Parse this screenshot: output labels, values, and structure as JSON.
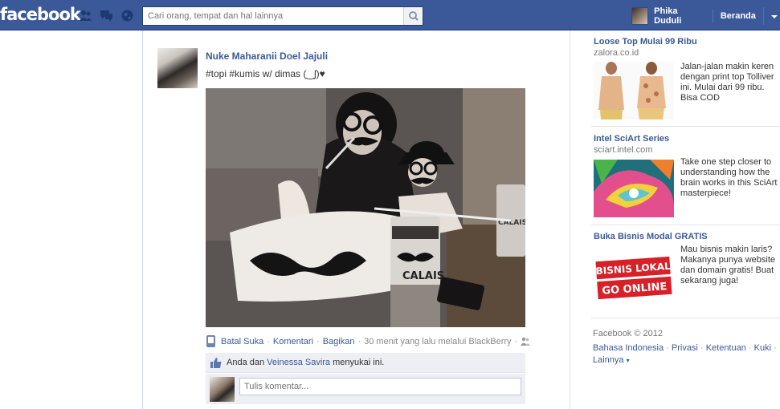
{
  "header": {
    "logo": "facebook",
    "search_placeholder": "Cari orang, tempat dan hal lainnya",
    "user_name": "Phika Duduli",
    "home_label": "Beranda"
  },
  "post": {
    "author": "Nuke Maharanii Doel Jajuli",
    "text": "#topi #kumis w/ dimas (‿ʃ)♥",
    "photo_texts": {
      "cup": "CALAIS",
      "cup_back": "CALAIS"
    },
    "actions": {
      "unlike": "Batal Suka",
      "comment": "Komentari",
      "share": "Bagikan",
      "timestamp": "30 menit yang lalu melalui BlackBerry"
    },
    "likes": {
      "you_and": "Anda dan",
      "friend": "Veinessa Savira",
      "suffix": "menyukai ini."
    },
    "comment_placeholder": "Tulis komentar..."
  },
  "ads": [
    {
      "title": "Loose Top Mulai 99 Ribu",
      "domain": "zalora.co.id",
      "text": "Jalan-jalan makin keren dengan print top Tolliver ini. Mulai dari 99 ribu. Bisa COD"
    },
    {
      "title": "Intel SciArt Series",
      "domain": "sciart.intel.com",
      "text": "Take one step closer to understanding how the brain works in this SciArt masterpiece!"
    },
    {
      "title": "Buka Bisnis Modal GRATIS",
      "domain": "",
      "text": "Mau bisnis makin laris? Makanya punya website dan domain gratis! Buat sekarang juga!",
      "image_text_line1": "BISNIS LOKAL",
      "image_text_line2": "GO ONLINE"
    }
  ],
  "footer": {
    "copyright": "Facebook © 2012",
    "links": [
      "Bahasa Indonesia",
      "Privasi",
      "Ketentuan",
      "Kuki",
      "Lainnya"
    ]
  },
  "colors": {
    "brand": "#3b5998",
    "link": "#3b5998",
    "like_bg": "#edeff4"
  }
}
